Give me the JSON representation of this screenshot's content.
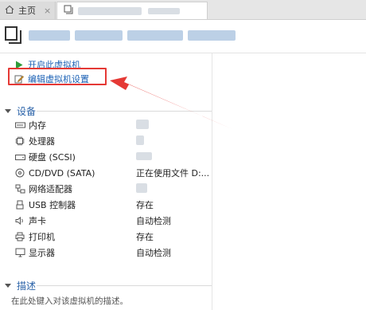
{
  "tabs": {
    "home_label": "主页",
    "close_glyph": "×"
  },
  "actions": {
    "start_label": "开启此虚拟机",
    "edit_label": "编辑虚拟机设置"
  },
  "devices_section": {
    "title": "设备",
    "items": [
      {
        "label": "内存",
        "value": "",
        "icon": "memory-icon"
      },
      {
        "label": "处理器",
        "value": "",
        "icon": "cpu-icon"
      },
      {
        "label": "硬盘 (SCSI)",
        "value": "",
        "icon": "harddisk-icon"
      },
      {
        "label": "CD/DVD (SATA)",
        "value": "正在使用文件 D:...",
        "icon": "cdrom-icon"
      },
      {
        "label": "网络适配器",
        "value": "",
        "icon": "network-icon"
      },
      {
        "label": "USB 控制器",
        "value": "存在",
        "icon": "usb-icon"
      },
      {
        "label": "声卡",
        "value": "自动检测",
        "icon": "sound-icon"
      },
      {
        "label": "打印机",
        "value": "存在",
        "icon": "printer-icon"
      },
      {
        "label": "显示器",
        "value": "自动检测",
        "icon": "display-icon"
      }
    ]
  },
  "description_section": {
    "title": "描述",
    "placeholder": "在此处键入对该虚拟机的描述。"
  },
  "colors": {
    "accent_blue": "#1a5fb4",
    "highlight_red": "#e53935",
    "play_green": "#2e9b3a"
  }
}
